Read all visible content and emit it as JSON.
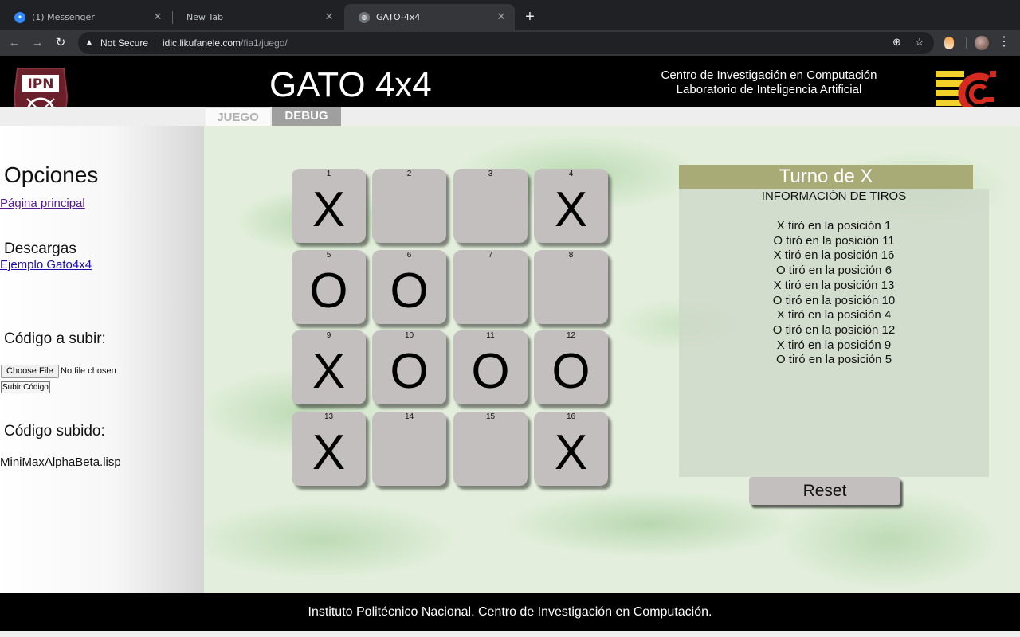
{
  "browser": {
    "tabs": [
      {
        "title": "(1) Messenger",
        "active": false
      },
      {
        "title": "New Tab",
        "active": false
      },
      {
        "title": "GATO-4x4",
        "active": true
      }
    ],
    "security_label": "Not Secure",
    "url_host": "idic.likufanele.com",
    "url_path": "/fia1/juego/"
  },
  "header": {
    "title": "GATO 4x4",
    "subtitle_line1": "Centro de Investigación en Computación",
    "subtitle_line2": "Laboratorio de Inteligencia Artificial",
    "logo_left_text": "IPN"
  },
  "tabs": {
    "juego": "JUEGO",
    "debug": "DEBUG"
  },
  "sidebar": {
    "options_heading": "Opciones",
    "main_page_link": "Página principal",
    "downloads_heading": "Descargas",
    "example_link": "Ejemplo Gato4x4",
    "upload_heading": "Código a subir:",
    "choose_file_label": "Choose File",
    "no_file_label": "No file chosen",
    "upload_button_label": "Subir Código",
    "uploaded_heading": "Código subido:",
    "uploaded_file": "MiniMaxAlphaBeta.lisp"
  },
  "board": {
    "cells": [
      {
        "num": "1",
        "mark": "X"
      },
      {
        "num": "2",
        "mark": ""
      },
      {
        "num": "3",
        "mark": ""
      },
      {
        "num": "4",
        "mark": "X"
      },
      {
        "num": "5",
        "mark": "O"
      },
      {
        "num": "6",
        "mark": "O"
      },
      {
        "num": "7",
        "mark": ""
      },
      {
        "num": "8",
        "mark": ""
      },
      {
        "num": "9",
        "mark": "X"
      },
      {
        "num": "10",
        "mark": "O"
      },
      {
        "num": "11",
        "mark": "O"
      },
      {
        "num": "12",
        "mark": "O"
      },
      {
        "num": "13",
        "mark": "X"
      },
      {
        "num": "14",
        "mark": ""
      },
      {
        "num": "15",
        "mark": ""
      },
      {
        "num": "16",
        "mark": "X"
      }
    ]
  },
  "info": {
    "turn": "Turno de X",
    "title": "INFORMACIÓN DE TIROS",
    "moves": [
      "X tiró en la posición 1",
      "O tiró en la posición 11",
      "X tiró en la posición 16",
      "O tiró en la posición 6",
      "X tiró en la posición 13",
      "O tiró en la posición 10",
      "X tiró en la posición 4",
      "O tiró en la posición 12",
      "X tiró en la posición 9",
      "O tiró en la posición 5"
    ],
    "reset_label": "Reset"
  },
  "footer": {
    "text": "Instituto Politécnico Nacional. Centro de Investigación en Computación."
  },
  "colors": {
    "turn_bar": "#a8ab76",
    "cell": "#c3bfbe",
    "header_bg": "#000000",
    "tab_debug": "#9f9f9f"
  }
}
